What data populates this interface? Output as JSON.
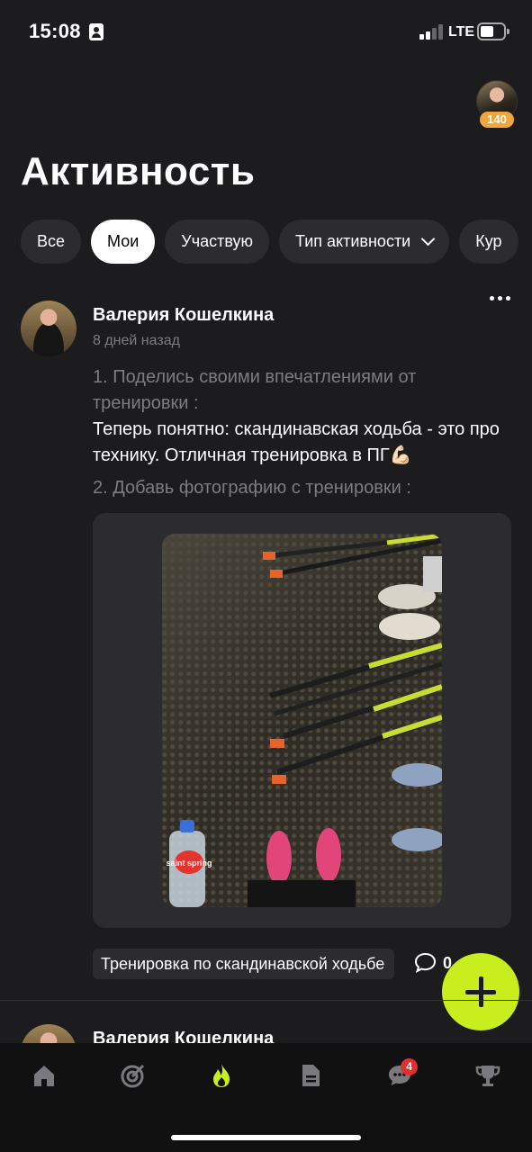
{
  "status_bar": {
    "time": "15:08",
    "network": "LTE",
    "icons": [
      "contact-card-icon",
      "signal-icon",
      "battery-icon"
    ]
  },
  "profile": {
    "points": "140"
  },
  "page": {
    "title": "Активность"
  },
  "filters": [
    {
      "label": "Все",
      "active": false
    },
    {
      "label": "Мои",
      "active": true
    },
    {
      "label": "Участвую",
      "active": false
    },
    {
      "label": "Тип активности",
      "active": false,
      "icon": "chevron-down-icon"
    },
    {
      "label": "Кур",
      "active": false
    }
  ],
  "post": {
    "author": "Валерия Кошелкина",
    "time_ago": "8 дней назад",
    "question1": "1. Поделись своими впечатлениями от тренировки :",
    "answer1": "Теперь понятно: скандинавская ходьба - это про технику. Отличная тренировка в ПГ💪🏻",
    "question2": "2. Добавь фотографию с тренировки :",
    "photo_bottle_text": "saint spring",
    "tag": "Тренировка по скандинавской ходьбе",
    "comments_count": "0"
  },
  "next_post": {
    "author": "Валерия Кошелкина"
  },
  "tabbar": {
    "items": [
      {
        "icon": "home-icon"
      },
      {
        "icon": "target-icon"
      },
      {
        "icon": "flame-icon",
        "active": true
      },
      {
        "icon": "document-icon"
      },
      {
        "icon": "chat-icon"
      },
      {
        "icon": "trophy-icon"
      }
    ],
    "chat_badge": "4",
    "accent": "#c9ee1e"
  },
  "colors": {
    "background": "#1c1c1e",
    "chip": "#2c2c2e",
    "muted_text": "#7d7d80",
    "points_badge": "#f0a63a",
    "fab": "#c9ee1e"
  }
}
